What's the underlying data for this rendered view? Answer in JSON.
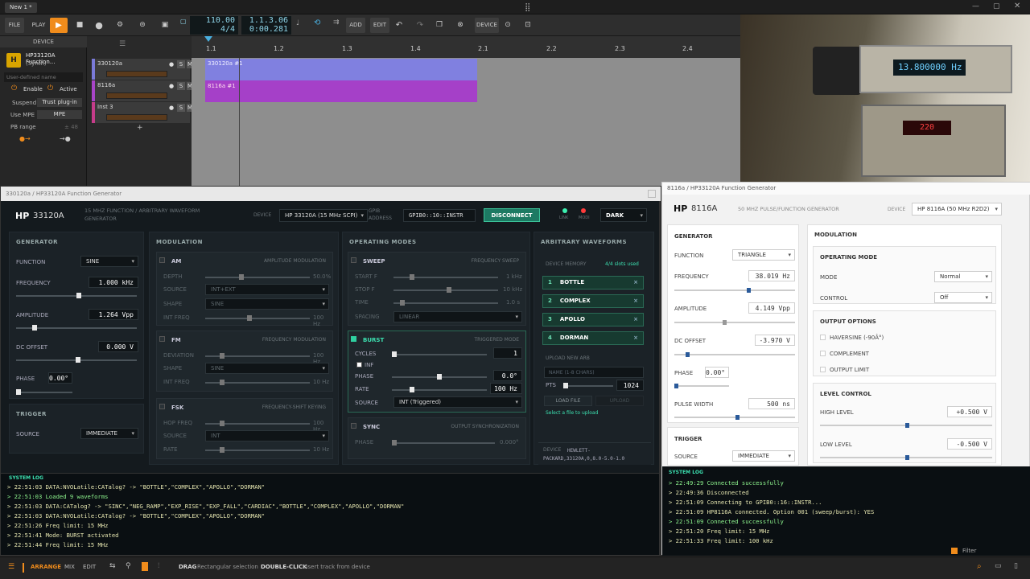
{
  "titlebar": {
    "tab": "New 1 *"
  },
  "toolbar": {
    "file": "FILE",
    "play": "PLAY",
    "add": "ADD",
    "edit": "EDIT",
    "device": "DEVICE",
    "tempo": "110.00",
    "meter": "4/4",
    "position": "1.1.3.06",
    "time": "0:00.281"
  },
  "device_panel": {
    "header": "DEVICE",
    "plugin_name": "HP33120A Function...",
    "plugin_type": "(Synth)",
    "user_name_placeholder": "User-defined name",
    "enable": "Enable",
    "active": "Active",
    "suspend": "Suspend",
    "suspend_value": "Trust plug-in",
    "use_mpe": "Use MPE",
    "mpe": "MPE",
    "pb_range": "PB range",
    "pb_value": "± 48"
  },
  "tracks": [
    {
      "name": "330120a",
      "color": "#7a7ad8"
    },
    {
      "name": "8116a",
      "color": "#a845c8"
    },
    {
      "name": "Inst 3",
      "color": "#c63c8a"
    }
  ],
  "ruler": [
    "1.1",
    "1.2",
    "1.3",
    "1.4",
    "2.1",
    "2.2",
    "2.3",
    "2.4"
  ],
  "clips": [
    "330120a #1",
    "8116a #1"
  ],
  "camera": {
    "display1": "13.800000",
    "unit1": "Hz",
    "display2": "220"
  },
  "hp33120a": {
    "window_title": "330120a / HP33120A Function Generator",
    "brand": "HP",
    "model": "33120A",
    "subtitle": "15 MHZ FUNCTION / ARBITRARY WAVEFORM GENERATOR",
    "device_label": "DEVICE",
    "device_value": "HP 33120A (15 MHz SCPI)",
    "gpib_label": "GPIB ADDRESS",
    "gpib_value": "GPIB0::10::INSTR",
    "disconnect": "DISCONNECT",
    "link": "LINK",
    "mod": "MODI",
    "theme": "DARK",
    "generator": {
      "title": "GENERATOR",
      "function_label": "FUNCTION",
      "function": "SINE",
      "frequency_label": "FREQUENCY",
      "frequency": "1.000 kHz",
      "amplitude_label": "AMPLITUDE",
      "amplitude": "1.264 Vpp",
      "offset_label": "DC OFFSET",
      "offset": "0.000 V",
      "phase_label": "PHASE",
      "phase": "0.00°"
    },
    "trigger": {
      "title": "TRIGGER",
      "source_label": "SOURCE",
      "source": "IMMEDIATE"
    },
    "modulation": {
      "title": "MODULATION",
      "am": {
        "name": "AM",
        "desc": "AMPLITUDE MODULATION",
        "depth": "DEPTH",
        "depth_val": "50.0%",
        "source": "SOURCE",
        "source_val": "INT+EXT",
        "shape": "SHAPE",
        "shape_val": "SINE",
        "freq": "INT FREQ",
        "freq_val": "100 Hz"
      },
      "fm": {
        "name": "FM",
        "desc": "FREQUENCY MODULATION",
        "dev": "DEVIATION",
        "dev_val": "100 Hz",
        "shape": "SHAPE",
        "shape_val": "SINE",
        "freq": "INT FREQ",
        "freq_val": "10 Hz"
      },
      "fsk": {
        "name": "FSK",
        "desc": "FREQUENCY-SHIFT KEYING",
        "hop": "HOP FREQ",
        "hop_val": "100 Hz",
        "source": "SOURCE",
        "source_val": "INT",
        "rate": "RATE",
        "rate_val": "10 Hz"
      }
    },
    "operating": {
      "title": "OPERATING MODES",
      "sweep": {
        "name": "SWEEP",
        "desc": "FREQUENCY SWEEP",
        "start": "START F",
        "start_val": "1 kHz",
        "stop": "STOP F",
        "stop_val": "10 kHz",
        "time": "TIME",
        "time_val": "1.0 s",
        "spacing": "SPACING",
        "spacing_val": "LINEAR"
      },
      "burst": {
        "name": "BURST",
        "desc": "TRIGGERED MODE",
        "cycles": "CYCLES",
        "cycles_val": "1",
        "inf": "INF",
        "phase": "PHASE",
        "phase_val": "0.0°",
        "rate": "RATE",
        "rate_val": "100 Hz",
        "source": "SOURCE",
        "source_val": "INT (Triggered)"
      },
      "sync": {
        "name": "SYNC",
        "desc": "OUTPUT SYNCHRONIZATION",
        "phase": "PHASE",
        "phase_val": "0.000°"
      }
    },
    "arb": {
      "title": "ARBITRARY WAVEFORMS",
      "memory": "DEVICE MEMORY",
      "slots": "4/4 slots used",
      "items": [
        {
          "n": "1",
          "name": "BOTTLE"
        },
        {
          "n": "2",
          "name": "COMPLEX"
        },
        {
          "n": "3",
          "name": "APOLLO"
        },
        {
          "n": "4",
          "name": "DORMAN"
        }
      ],
      "upload_new": "UPLOAD NEW ARB",
      "name_placeholder": "NAME (1-8 CHARS)",
      "pts": "PTS",
      "pts_val": "1024",
      "load": "LOAD FILE",
      "upload": "UPLOAD",
      "hint": "Select a file to upload",
      "device": "DEVICE",
      "device_id": "HEWLETT-PACKARD,33120A,0,8.0-5.0-1.0"
    },
    "log_title": "SYSTEM LOG",
    "log": [
      {
        "t": "> 22:51:03 DATA:NVOLatile:CATalog? -> \"BOTTLE\",\"COMPLEX\",\"APOLLO\",\"DORMAN\"",
        "ok": false
      },
      {
        "t": "> 22:51:03 Loaded 9 waveforms",
        "ok": true
      },
      {
        "t": "> 22:51:03 DATA:CATalog? -> \"SINC\",\"NEG_RAMP\",\"EXP_RISE\",\"EXP_FALL\",\"CARDIAC\",\"BOTTLE\",\"COMPLEX\",\"APOLLO\",\"DORMAN\"",
        "ok": false
      },
      {
        "t": "> 22:51:03 DATA:NVOLatile:CATalog? -> \"BOTTLE\",\"COMPLEX\",\"APOLLO\",\"DORMAN\"",
        "ok": false
      },
      {
        "t": "> 22:51:26 Freq limit: 15 MHz",
        "ok": false
      },
      {
        "t": "> 22:51:41 Mode: BURST activated",
        "ok": false
      },
      {
        "t": "> 22:51:44 Freq limit: 15 MHz",
        "ok": false
      }
    ]
  },
  "hp8116a": {
    "window_title": "8116a / HP33120A Function Generator",
    "brand": "HP",
    "model": "8116A",
    "subtitle": "50 MHZ PULSE/FUNCTION GENERATOR",
    "device_label": "DEVICE",
    "device_value": "HP 8116A (50 MHz R2D2)",
    "generator": {
      "title": "GENERATOR",
      "function_label": "FUNCTION",
      "function": "TRIANGLE",
      "frequency_label": "FREQUENCY",
      "frequency": "38.019 Hz",
      "amplitude_label": "AMPLITUDE",
      "amplitude": "4.149 Vpp",
      "offset_label": "DC OFFSET",
      "offset": "-3.970 V",
      "phase_label": "PHASE",
      "phase": "0.00°",
      "pw_label": "PULSE WIDTH",
      "pw": "500 ns"
    },
    "trigger": {
      "title": "TRIGGER",
      "source_label": "SOURCE",
      "source": "IMMEDIATE"
    },
    "modulation": {
      "title": "MODULATION",
      "op_title": "OPERATING MODE",
      "mode_label": "MODE",
      "mode": "Normal",
      "control_label": "CONTROL",
      "control": "Off",
      "out_title": "OUTPUT OPTIONS",
      "haversine": "HAVERSINE (-90Â°)",
      "complement": "COMPLEMENT",
      "limit": "OUTPUT LIMIT",
      "lvl_title": "LEVEL CONTROL",
      "high_label": "HIGH LEVEL",
      "high": "+0.500 V",
      "low_label": "LOW LEVEL",
      "low": "-0.500 V"
    },
    "log_title": "SYSTEM LOG",
    "log": [
      {
        "t": "> 22:49:29 Connected successfully",
        "ok": true
      },
      {
        "t": "> 22:49:36 Disconnected",
        "ok": false
      },
      {
        "t": "> 22:51:09 Connecting to GPIB0::16::INSTR...",
        "ok": false
      },
      {
        "t": "> 22:51:09 HP8116A connected. Option 001 (sweep/burst): YES",
        "ok": false
      },
      {
        "t": "> 22:51:09 Connected successfully",
        "ok": true
      },
      {
        "t": "> 22:51:20 Freq limit: 15 MHz",
        "ok": false
      },
      {
        "t": "> 22:51:33 Freq limit: 100 kHz",
        "ok": false
      }
    ]
  },
  "bottom": {
    "arrange": "ARRANGE",
    "mix": "MIX",
    "edit": "EDIT",
    "drag": "DRAG",
    "drag_desc": "Rectangular selection",
    "dbl": "DOUBLE-CLICK",
    "dbl_desc": "Insert track from device",
    "filter": "Filter"
  }
}
